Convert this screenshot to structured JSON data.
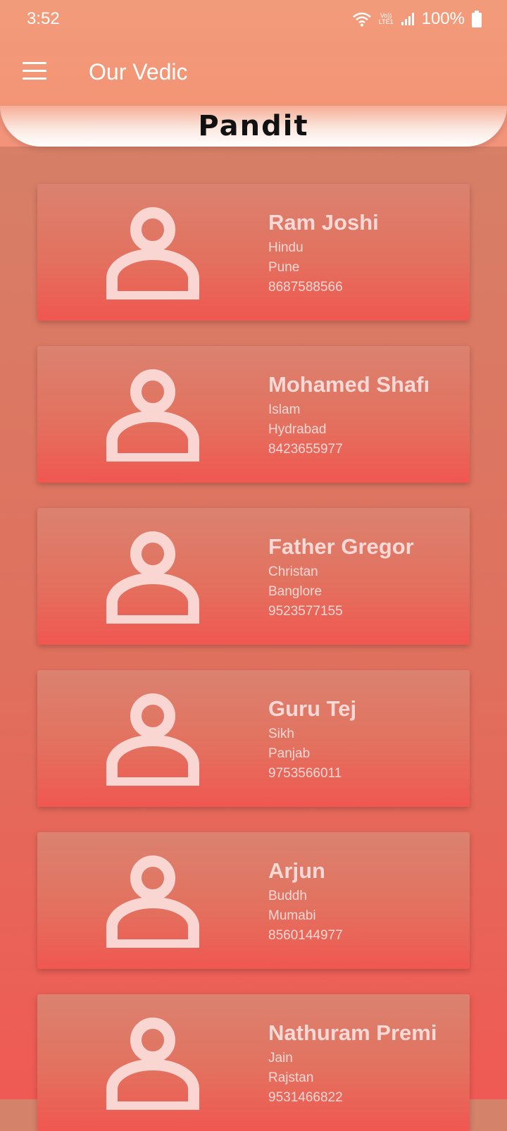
{
  "status": {
    "time": "3:52",
    "network_top": "Vo))",
    "network_bottom": "LTE1",
    "battery": "100%"
  },
  "appbar": {
    "title": "Our Vedic",
    "section": "Pandit"
  },
  "pandits": [
    {
      "name": "Ram Joshi",
      "religion": "Hindu",
      "city": "Pune",
      "phone": "8687588566"
    },
    {
      "name": "Mohamed Shafı",
      "religion": "Islam",
      "city": "Hydrabad",
      "phone": "8423655977"
    },
    {
      "name": "Father Gregor",
      "religion": "Christan",
      "city": "Banglore",
      "phone": "9523577155"
    },
    {
      "name": "Guru Tej",
      "religion": "Sikh",
      "city": "Panjab",
      "phone": "9753566011"
    },
    {
      "name": "Arjun",
      "religion": "Buddh",
      "city": "Mumabi",
      "phone": "8560144977"
    },
    {
      "name": "Nathuram Premi",
      "religion": "Jain",
      "city": "Rajstan",
      "phone": "9531466822"
    }
  ],
  "colors": {
    "accent": "#f29b7a",
    "card_text": "#f9d9d6"
  }
}
